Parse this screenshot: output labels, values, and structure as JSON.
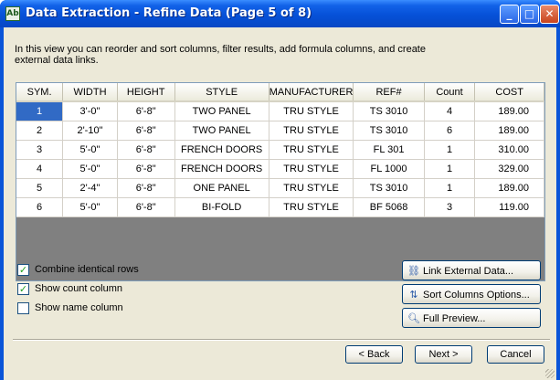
{
  "window": {
    "title": "Data Extraction - Refine Data (Page 5 of 8)",
    "icon": "Ab",
    "minimize_glyph": "_",
    "maximize_glyph": "□",
    "close_glyph": "✕"
  },
  "description": "In this view you can reorder and sort columns, filter results, add formula columns, and create external data links.",
  "grid": {
    "columns": [
      "SYM.",
      "WIDTH",
      "HEIGHT",
      "STYLE",
      "MANUFACTURER",
      "REF#",
      "Count",
      "COST"
    ],
    "rows": [
      [
        "1",
        "3'-0\"",
        "6'-8\"",
        "TWO PANEL",
        "TRU STYLE",
        "TS 3010",
        "4",
        "189.00"
      ],
      [
        "2",
        "2'-10\"",
        "6'-8\"",
        "TWO PANEL",
        "TRU STYLE",
        "TS 3010",
        "6",
        "189.00"
      ],
      [
        "3",
        "5'-0\"",
        "6'-8\"",
        "FRENCH DOORS",
        "TRU STYLE",
        "FL 301",
        "1",
        "310.00"
      ],
      [
        "4",
        "5'-0\"",
        "6'-8\"",
        "FRENCH DOORS",
        "TRU STYLE",
        "FL 1000",
        "1",
        "329.00"
      ],
      [
        "5",
        "2'-4\"",
        "6'-8\"",
        "ONE PANEL",
        "TRU STYLE",
        "TS 3010",
        "1",
        "189.00"
      ],
      [
        "6",
        "5'-0\"",
        "6'-8\"",
        "BI-FOLD",
        "TRU STYLE",
        "BF 5068",
        "3",
        "119.00"
      ]
    ],
    "selected_row": 0
  },
  "options": {
    "combine": {
      "label": "Combine identical rows",
      "checked": true
    },
    "count": {
      "label": "Show count column",
      "checked": true
    },
    "name": {
      "label": "Show name column",
      "checked": false
    }
  },
  "buttons": {
    "link_external": "Link External Data...",
    "sort_columns": "Sort Columns Options...",
    "full_preview": "Full Preview...",
    "back": "< Back",
    "next": "Next >",
    "cancel": "Cancel"
  },
  "colors": {
    "title_bar": "#0651d8",
    "selection": "#316ac5",
    "dialog_bg": "#ece9d8",
    "grid_bg": "#808080"
  }
}
